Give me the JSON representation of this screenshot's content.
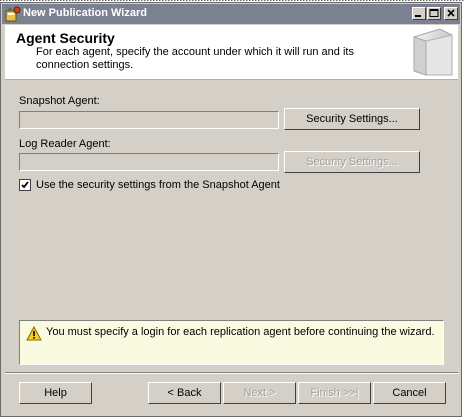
{
  "window": {
    "title": "New Publication Wizard"
  },
  "header": {
    "title": "Agent Security",
    "subtitle": "For each agent, specify the account under which it will run and its connection settings."
  },
  "snapshot_agent": {
    "label": "Snapshot Agent:",
    "value": "",
    "button_label": "Security Settings..."
  },
  "log_reader_agent": {
    "label": "Log Reader Agent:",
    "value": "",
    "button_label": "Security Settings..."
  },
  "use_snapshot_settings": {
    "label": "Use the security settings from the Snapshot Agent",
    "checked": true
  },
  "message": {
    "icon": "warning-icon",
    "text": "You must specify a login for each replication agent before continuing the wizard."
  },
  "footer": {
    "help_label": "Help",
    "back_label": "< Back",
    "next_label": "Next >",
    "finish_label": "Finish >>|",
    "cancel_label": "Cancel"
  },
  "colors": {
    "titlebar": "#7a8292",
    "dialog_bg": "#d4d0c8",
    "message_bg": "#fafae0"
  }
}
